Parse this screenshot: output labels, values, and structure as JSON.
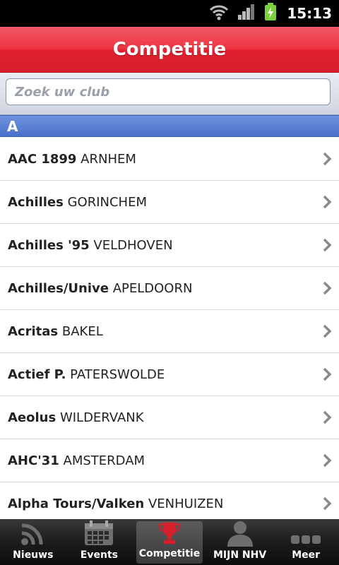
{
  "status_bar": {
    "time": "15:13"
  },
  "header": {
    "title": "Competitie"
  },
  "search": {
    "placeholder": "Zoek uw club"
  },
  "section": {
    "letter": "A"
  },
  "clubs": [
    {
      "club": "AAC 1899",
      "city": "ARNHEM"
    },
    {
      "club": "Achilles",
      "city": "GORINCHEM"
    },
    {
      "club": "Achilles '95",
      "city": "VELDHOVEN"
    },
    {
      "club": "Achilles/Unive",
      "city": "APELDOORN"
    },
    {
      "club": "Acritas",
      "city": "BAKEL"
    },
    {
      "club": "Actief P.",
      "city": "PATERSWOLDE"
    },
    {
      "club": "Aeolus",
      "city": "WILDERVANK"
    },
    {
      "club": "AHC'31",
      "city": "AMSTERDAM"
    },
    {
      "club": "Alpha Tours/Valken",
      "city": "VENHUIZEN"
    }
  ],
  "tabs": [
    {
      "label": "Nieuws",
      "icon": "rss-icon",
      "active": false
    },
    {
      "label": "Events",
      "icon": "calendar-icon",
      "active": false
    },
    {
      "label": "Competitie",
      "icon": "trophy-icon",
      "active": true
    },
    {
      "label": "MIJN NHV",
      "icon": "person-icon",
      "active": false
    },
    {
      "label": "Meer",
      "icon": "more-dots-icon",
      "active": false
    }
  ],
  "colors": {
    "header_red": "#e0202e",
    "section_blue": "#4a70cc",
    "trophy_red": "#d81e2b"
  }
}
